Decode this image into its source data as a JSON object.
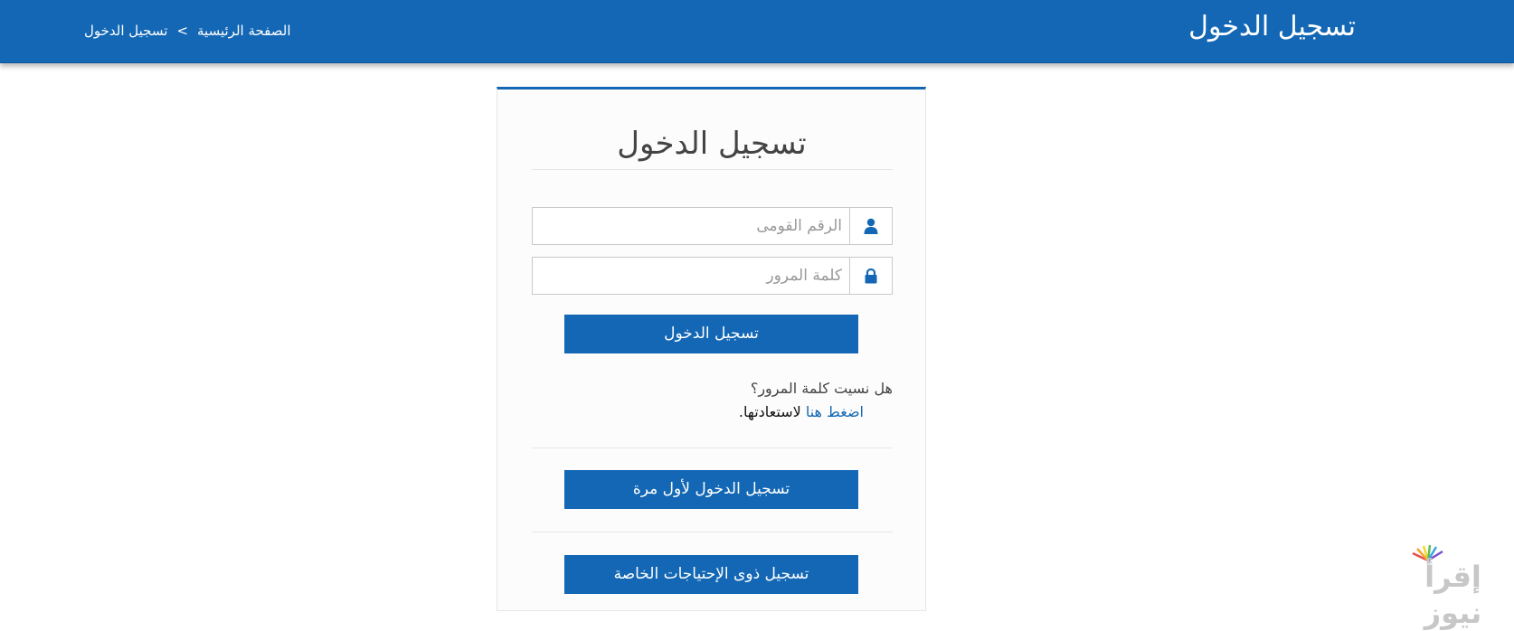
{
  "header": {
    "title": "تسجيل الدخول",
    "breadcrumb": {
      "home": "الصفحة الرئيسية",
      "separator": ">",
      "current": "تسجيل الدخول"
    }
  },
  "login_card": {
    "title": "تسجيل الدخول",
    "national_id": {
      "placeholder": "الرقم القومى",
      "value": "",
      "icon": "user-icon"
    },
    "password": {
      "placeholder": "كلمة المرور",
      "value": "",
      "icon": "lock-icon"
    },
    "login_button": "تسجيل الدخول",
    "forgot": {
      "question": "هل نسيت كلمة المرور؟",
      "link": "اضغط هنا",
      "suffix": "لاستعادتها."
    },
    "first_time_button": "تسجيل الدخول لأول مرة",
    "special_needs_button": "تسجيل ذوى الإحتياجات الخاصة"
  },
  "watermark": {
    "text": "إقرأ نيوز"
  },
  "colors": {
    "brand": "#1367b4",
    "text": "#444444",
    "link": "#1367b4"
  }
}
